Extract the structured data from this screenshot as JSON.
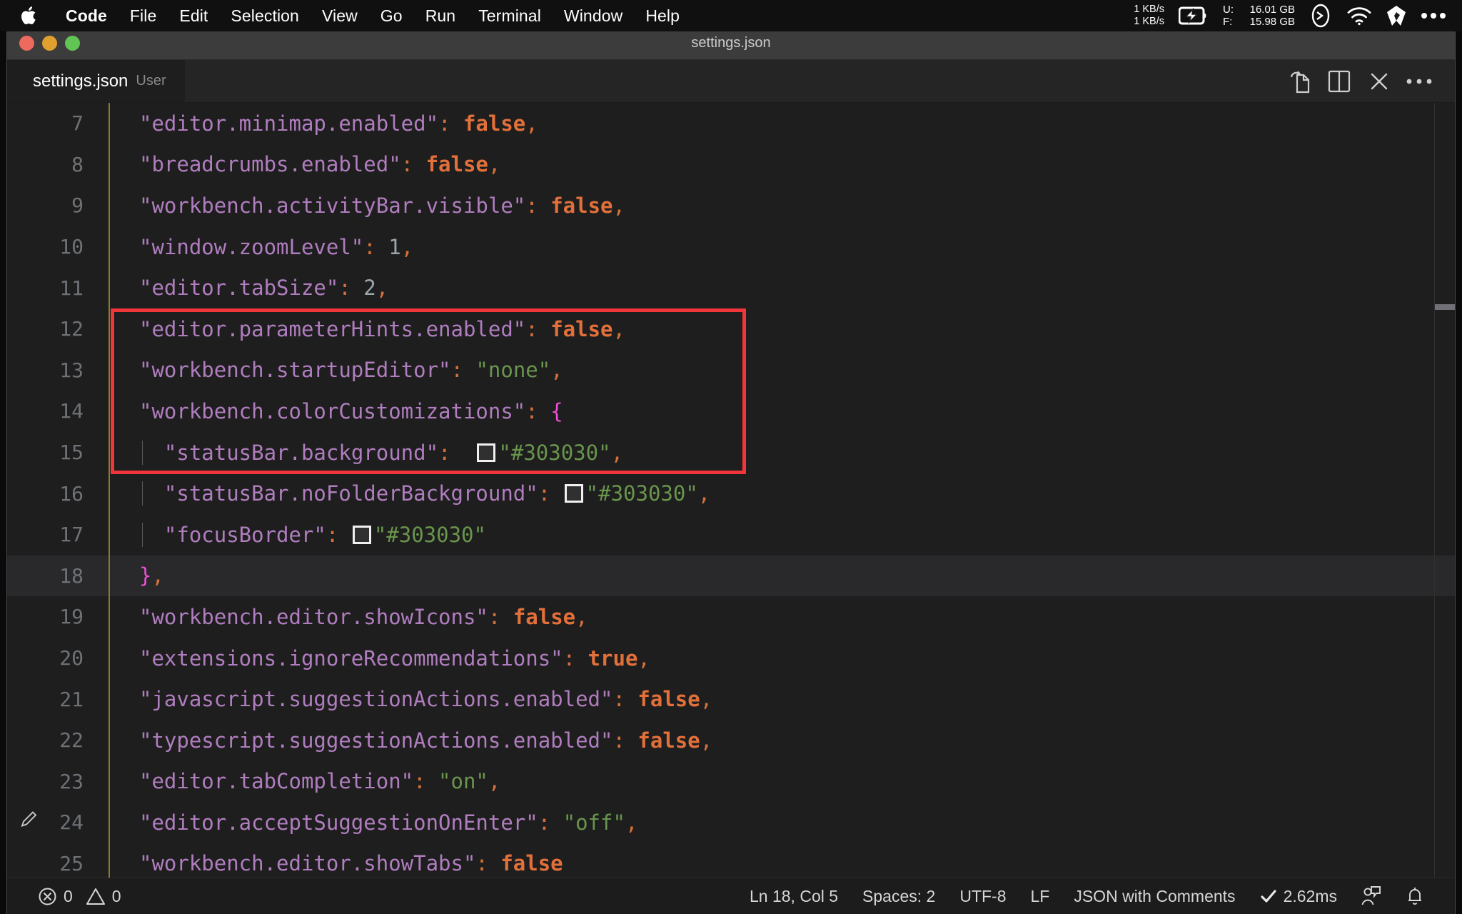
{
  "menubar": {
    "apple_icon": "apple-logo-icon",
    "items": [
      "Code",
      "File",
      "Edit",
      "Selection",
      "View",
      "Go",
      "Run",
      "Terminal",
      "Window",
      "Help"
    ],
    "network_up": "1 KB/s",
    "network_down": "1 KB/s",
    "battery_icon": "battery-charging-icon",
    "memory": [
      {
        "label": "U:",
        "value": "16.01 GB"
      },
      {
        "label": "F:",
        "value": "15.98 GB"
      }
    ],
    "right_icons": [
      "terminal-prompt-icon",
      "wifi-icon",
      "dropbox-icon",
      "control-center-icon"
    ]
  },
  "window": {
    "title": "settings.json",
    "traffic_lights": [
      "close-button",
      "minimize-button",
      "maximize-button"
    ],
    "colors": {
      "close": "#ed6a5e",
      "minimize": "#e0a02f",
      "maximize": "#61c555"
    }
  },
  "tabbar": {
    "tab_name": "settings.json",
    "tab_description": "User",
    "actions": [
      "open-changes-icon",
      "split-editor-icon",
      "close-editor-icon",
      "more-actions-icon"
    ]
  },
  "editor": {
    "indent_guide_color": "#8c7a2a",
    "highlight_box_color": "#f0363a",
    "current_line": 18,
    "color_swatch_value": "#303030",
    "lines": [
      {
        "n": "7",
        "indent": 1,
        "tokens": [
          {
            "t": "\"editor.minimap.enabled\"",
            "c": "k"
          },
          {
            "t": ":",
            "c": "p"
          },
          {
            "t": " ",
            "c": "w"
          },
          {
            "t": "false",
            "c": "b"
          },
          {
            "t": ",",
            "c": "p"
          }
        ]
      },
      {
        "n": "8",
        "indent": 1,
        "tokens": [
          {
            "t": "\"breadcrumbs.enabled\"",
            "c": "k"
          },
          {
            "t": ":",
            "c": "p"
          },
          {
            "t": " ",
            "c": "w"
          },
          {
            "t": "false",
            "c": "b"
          },
          {
            "t": ",",
            "c": "p"
          }
        ]
      },
      {
        "n": "9",
        "indent": 1,
        "tokens": [
          {
            "t": "\"workbench.activityBar.visible\"",
            "c": "k"
          },
          {
            "t": ":",
            "c": "p"
          },
          {
            "t": " ",
            "c": "w"
          },
          {
            "t": "false",
            "c": "b"
          },
          {
            "t": ",",
            "c": "p"
          }
        ]
      },
      {
        "n": "10",
        "indent": 1,
        "tokens": [
          {
            "t": "\"window.zoomLevel\"",
            "c": "k"
          },
          {
            "t": ":",
            "c": "p"
          },
          {
            "t": " ",
            "c": "w"
          },
          {
            "t": "1",
            "c": "num"
          },
          {
            "t": ",",
            "c": "p"
          }
        ]
      },
      {
        "n": "11",
        "indent": 1,
        "tokens": [
          {
            "t": "\"editor.tabSize\"",
            "c": "k"
          },
          {
            "t": ":",
            "c": "p"
          },
          {
            "t": " ",
            "c": "w"
          },
          {
            "t": "2",
            "c": "num"
          },
          {
            "t": ",",
            "c": "p"
          }
        ]
      },
      {
        "n": "12",
        "indent": 1,
        "tokens": [
          {
            "t": "\"editor.parameterHints.enabled\"",
            "c": "k"
          },
          {
            "t": ":",
            "c": "p"
          },
          {
            "t": " ",
            "c": "w"
          },
          {
            "t": "false",
            "c": "b"
          },
          {
            "t": ",",
            "c": "p"
          }
        ]
      },
      {
        "n": "13",
        "indent": 1,
        "tokens": [
          {
            "t": "\"workbench.startupEditor\"",
            "c": "k"
          },
          {
            "t": ":",
            "c": "p"
          },
          {
            "t": " ",
            "c": "w"
          },
          {
            "t": "\"none\"",
            "c": "str"
          },
          {
            "t": ",",
            "c": "p"
          }
        ]
      },
      {
        "n": "14",
        "indent": 1,
        "tokens": [
          {
            "t": "\"workbench.colorCustomizations\"",
            "c": "k"
          },
          {
            "t": ":",
            "c": "p"
          },
          {
            "t": " ",
            "c": "w"
          },
          {
            "t": "{",
            "c": "br"
          }
        ]
      },
      {
        "n": "15",
        "indent": 2,
        "tokens": [
          {
            "t": "\"statusBar.background\"",
            "c": "k"
          },
          {
            "t": ":",
            "c": "p"
          },
          {
            "t": "  ",
            "c": "w"
          },
          {
            "t": "",
            "c": "swatch"
          },
          {
            "t": "\"#303030\"",
            "c": "str"
          },
          {
            "t": ",",
            "c": "p"
          }
        ]
      },
      {
        "n": "16",
        "indent": 2,
        "tokens": [
          {
            "t": "\"statusBar.noFolderBackground\"",
            "c": "k"
          },
          {
            "t": ":",
            "c": "p"
          },
          {
            "t": " ",
            "c": "w"
          },
          {
            "t": "",
            "c": "swatch"
          },
          {
            "t": "\"#303030\"",
            "c": "str"
          },
          {
            "t": ",",
            "c": "p"
          }
        ]
      },
      {
        "n": "17",
        "indent": 2,
        "tokens": [
          {
            "t": "\"focusBorder\"",
            "c": "k"
          },
          {
            "t": ":",
            "c": "p"
          },
          {
            "t": " ",
            "c": "w"
          },
          {
            "t": "",
            "c": "swatch"
          },
          {
            "t": "\"#303030\"",
            "c": "str"
          }
        ]
      },
      {
        "n": "18",
        "indent": 1,
        "current": true,
        "tokens": [
          {
            "t": "}",
            "c": "br"
          },
          {
            "t": ",",
            "c": "p"
          }
        ]
      },
      {
        "n": "19",
        "indent": 1,
        "tokens": [
          {
            "t": "\"workbench.editor.showIcons\"",
            "c": "k"
          },
          {
            "t": ":",
            "c": "p"
          },
          {
            "t": " ",
            "c": "w"
          },
          {
            "t": "false",
            "c": "b"
          },
          {
            "t": ",",
            "c": "p"
          }
        ]
      },
      {
        "n": "20",
        "indent": 1,
        "tokens": [
          {
            "t": "\"extensions.ignoreRecommendations\"",
            "c": "k"
          },
          {
            "t": ":",
            "c": "p"
          },
          {
            "t": " ",
            "c": "w"
          },
          {
            "t": "true",
            "c": "b"
          },
          {
            "t": ",",
            "c": "p"
          }
        ]
      },
      {
        "n": "21",
        "indent": 1,
        "tokens": [
          {
            "t": "\"javascript.suggestionActions.enabled\"",
            "c": "k"
          },
          {
            "t": ":",
            "c": "p"
          },
          {
            "t": " ",
            "c": "w"
          },
          {
            "t": "false",
            "c": "b"
          },
          {
            "t": ",",
            "c": "p"
          }
        ]
      },
      {
        "n": "22",
        "indent": 1,
        "tokens": [
          {
            "t": "\"typescript.suggestionActions.enabled\"",
            "c": "k"
          },
          {
            "t": ":",
            "c": "p"
          },
          {
            "t": " ",
            "c": "w"
          },
          {
            "t": "false",
            "c": "b"
          },
          {
            "t": ",",
            "c": "p"
          }
        ]
      },
      {
        "n": "23",
        "indent": 1,
        "tokens": [
          {
            "t": "\"editor.tabCompletion\"",
            "c": "k"
          },
          {
            "t": ":",
            "c": "p"
          },
          {
            "t": " ",
            "c": "w"
          },
          {
            "t": "\"on\"",
            "c": "str"
          },
          {
            "t": ",",
            "c": "p"
          }
        ]
      },
      {
        "n": "24",
        "indent": 1,
        "pencil": true,
        "tokens": [
          {
            "t": "\"editor.acceptSuggestionOnEnter\"",
            "c": "k"
          },
          {
            "t": ":",
            "c": "p"
          },
          {
            "t": " ",
            "c": "w"
          },
          {
            "t": "\"off\"",
            "c": "str"
          },
          {
            "t": ",",
            "c": "p"
          }
        ]
      },
      {
        "n": "25",
        "indent": 1,
        "tokens": [
          {
            "t": "\"workbench.editor.showTabs\"",
            "c": "k"
          },
          {
            "t": ":",
            "c": "p"
          },
          {
            "t": " ",
            "c": "w"
          },
          {
            "t": "false",
            "c": "b"
          }
        ]
      }
    ]
  },
  "statusbar": {
    "errors_icon": "error-circle-icon",
    "errors": "0",
    "warnings_icon": "warning-triangle-icon",
    "warnings": "0",
    "position": "Ln 18, Col 5",
    "indentation": "Spaces: 2",
    "encoding": "UTF-8",
    "eol": "LF",
    "language": "JSON with Comments",
    "tokenization": "2.62ms",
    "tokenization_icon": "check-icon",
    "feedback_icon": "feedback-person-icon",
    "notifications_icon": "bell-icon"
  }
}
